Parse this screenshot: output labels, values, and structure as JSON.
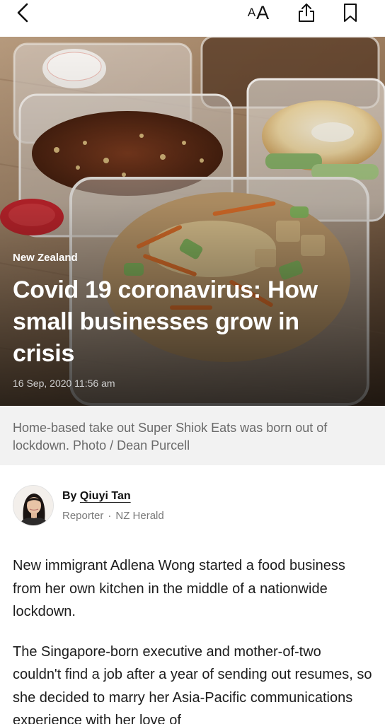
{
  "toolbar": {
    "back_icon": "chevron-left-icon",
    "text_size_small": "A",
    "text_size_large": "A",
    "share_icon": "share-icon",
    "bookmark_icon": "bookmark-icon"
  },
  "article": {
    "category": "New Zealand",
    "headline": "Covid 19 coronavirus: How small businesses grow in crisis",
    "timestamp": "16 Sep, 2020 11:56 am",
    "caption": "Home-based take out Super Shiok Eats was born out of lockdown. Photo / Dean Purcell",
    "byline_prefix": "By",
    "author": "Qiuyi Tan",
    "author_role": "Reporter",
    "separator": "·",
    "publisher": "NZ Herald",
    "paragraphs": [
      "New immigrant Adlena Wong started a food business from her own kitchen in the middle of a nationwide lockdown.",
      "The Singapore-born executive and mother-of-two couldn't find a job after a year of sending out resumes, so she decided to marry her Asia-Pacific communications experience with her love of"
    ]
  },
  "colors": {
    "text_primary": "#1a1a1a",
    "caption_bg": "#f2f2f2",
    "caption_text": "#6a6a6a",
    "meta_text": "#7a7a7a"
  }
}
